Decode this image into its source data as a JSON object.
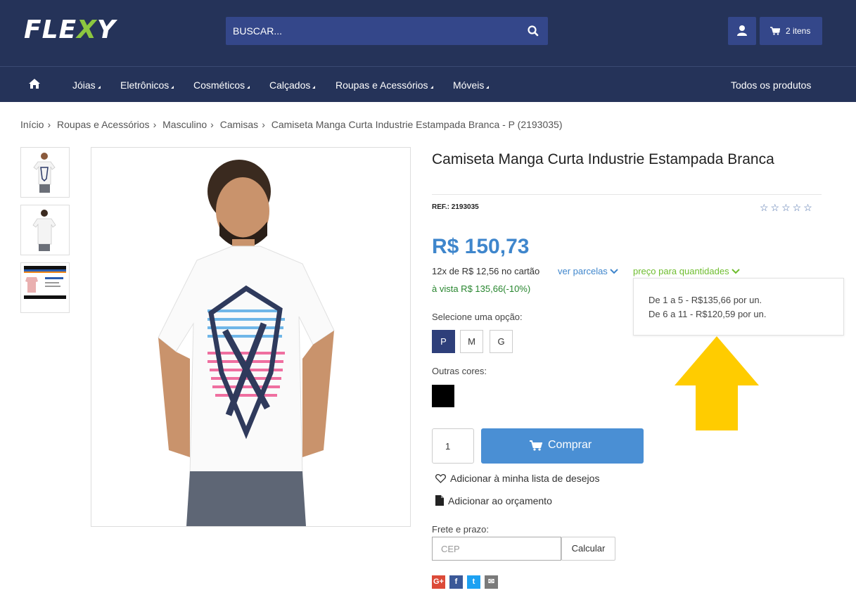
{
  "header": {
    "logo_left": "FLE",
    "logo_x": "X",
    "logo_right": "Y",
    "search_placeholder": "BUSCAR...",
    "cart_label": "2 itens"
  },
  "nav": {
    "items": [
      "Jóias",
      "Eletrônicos",
      "Cosméticos",
      "Calçados",
      "Roupas e Acessórios",
      "Móveis"
    ],
    "all_products": "Todos os produtos"
  },
  "breadcrumb": [
    "Início",
    "Roupas e Acessórios",
    "Masculino",
    "Camisas",
    "Camiseta Manga Curta Industrie Estampada Branca - P (2193035)"
  ],
  "product": {
    "title": "Camiseta Manga Curta Industrie Estampada Branca",
    "ref": "REF.: 2193035",
    "rating": "☆☆☆☆☆",
    "price": "R$ 150,73",
    "installments": "12x de R$ 12,56 no cartão",
    "ver_parcelas": "ver parcelas",
    "preco_quantidades": "preço para quantidades",
    "a_vista": "à vista R$ 135,66(-10%)",
    "quantity_prices": [
      "De 1 a 5 - R$135,66 por un.",
      "De 6 a 11 - R$120,59 por un."
    ],
    "select_option_label": "Selecione uma opção:",
    "sizes": [
      "P",
      "M",
      "G"
    ],
    "selected_size": "P",
    "other_colors_label": "Outras cores:",
    "qty": "1",
    "buy_label": "Comprar",
    "wishlist_label": "Adicionar à minha lista de desejos",
    "quote_label": "Adicionar ao orçamento",
    "frete_label": "Frete e prazo:",
    "cep_placeholder": "CEP",
    "calc_label": "Calcular"
  },
  "share": [
    "G+",
    "f",
    "t",
    "✉"
  ],
  "colors": {
    "header_bg": "#253359",
    "price": "#3f86cc",
    "buy_button": "#4a8fd4",
    "arrow": "#ffcc00",
    "green": "#6fbd2f"
  }
}
